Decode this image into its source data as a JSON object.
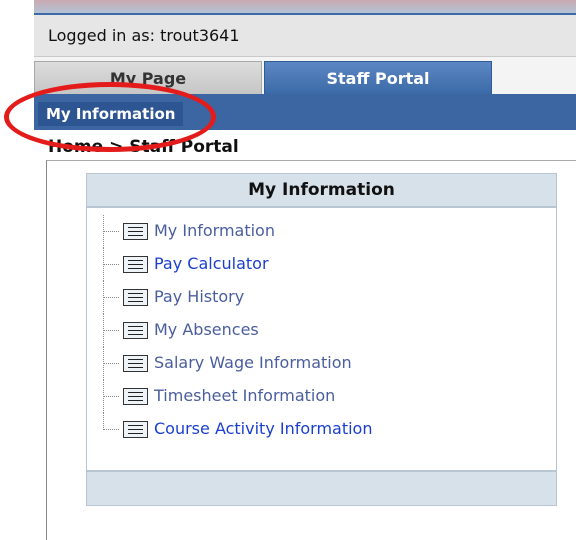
{
  "header": {
    "logged_in_text": "Logged in as: trout3641"
  },
  "tabs": [
    {
      "label": "My Page",
      "selected": false
    },
    {
      "label": "Staff Portal",
      "selected": true
    }
  ],
  "subnav": {
    "active_item": "My Information"
  },
  "breadcrumb": "Home > Staff Portal",
  "panel": {
    "title": "My Information",
    "items": [
      {
        "label": "My Information"
      },
      {
        "label": "Pay Calculator"
      },
      {
        "label": "Pay History"
      },
      {
        "label": "My Absences"
      },
      {
        "label": "Salary Wage Information"
      },
      {
        "label": "Timesheet Information"
      },
      {
        "label": "Course Activity Information"
      }
    ]
  },
  "colors": {
    "tab_active": "#3c6aa8",
    "subnav": "#3b66a2",
    "highlight_circle": "#e41b1b",
    "panel_header": "#d6e1ea",
    "link": "#1a3fd0"
  },
  "icons": {
    "tree_item_icon": "document-list-icon"
  }
}
